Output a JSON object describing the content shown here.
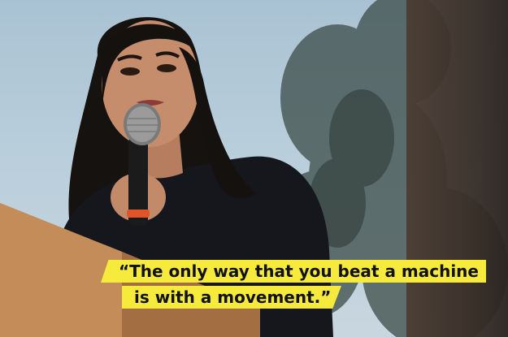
{
  "photo": {
    "description_icon": "person-with-microphone",
    "colors": {
      "sky": "#b9cedb",
      "tree": "#3a4a46",
      "trunk": "#3a2f28",
      "coat": "#14161c",
      "hair": "#15110f",
      "skin": "#c28a6a",
      "podium": "#b07a4a",
      "caption_bg": "#f6eb3d",
      "caption_text": "#111111"
    }
  },
  "caption": {
    "line1": "“The only way that you beat a machine",
    "line2": "is with a movement.”"
  }
}
